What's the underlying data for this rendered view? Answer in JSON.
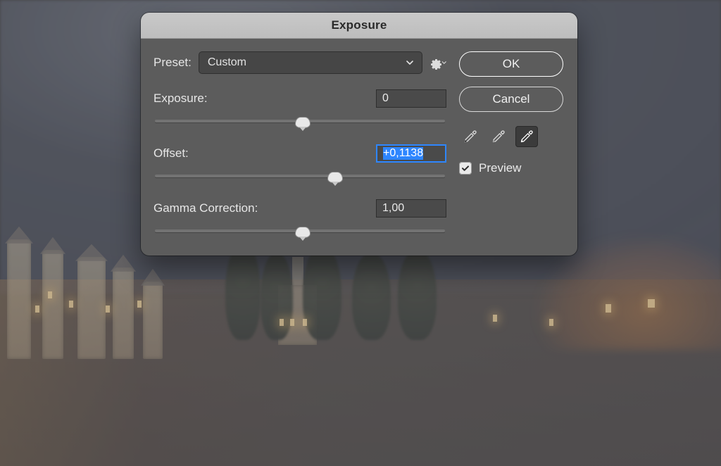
{
  "dialog": {
    "title": "Exposure",
    "preset_label": "Preset:",
    "preset_value": "Custom",
    "params": {
      "exposure": {
        "label": "Exposure:",
        "value": "0",
        "thumb_pct": 51
      },
      "offset": {
        "label": "Offset:",
        "value": "+0,1138",
        "thumb_pct": 62,
        "focused": true
      },
      "gamma": {
        "label": "Gamma Correction:",
        "value": "1,00",
        "thumb_pct": 51
      }
    },
    "buttons": {
      "ok": "OK",
      "cancel": "Cancel"
    },
    "preview": {
      "label": "Preview",
      "checked": true
    },
    "eyedroppers": {
      "selected_index": 2
    }
  }
}
